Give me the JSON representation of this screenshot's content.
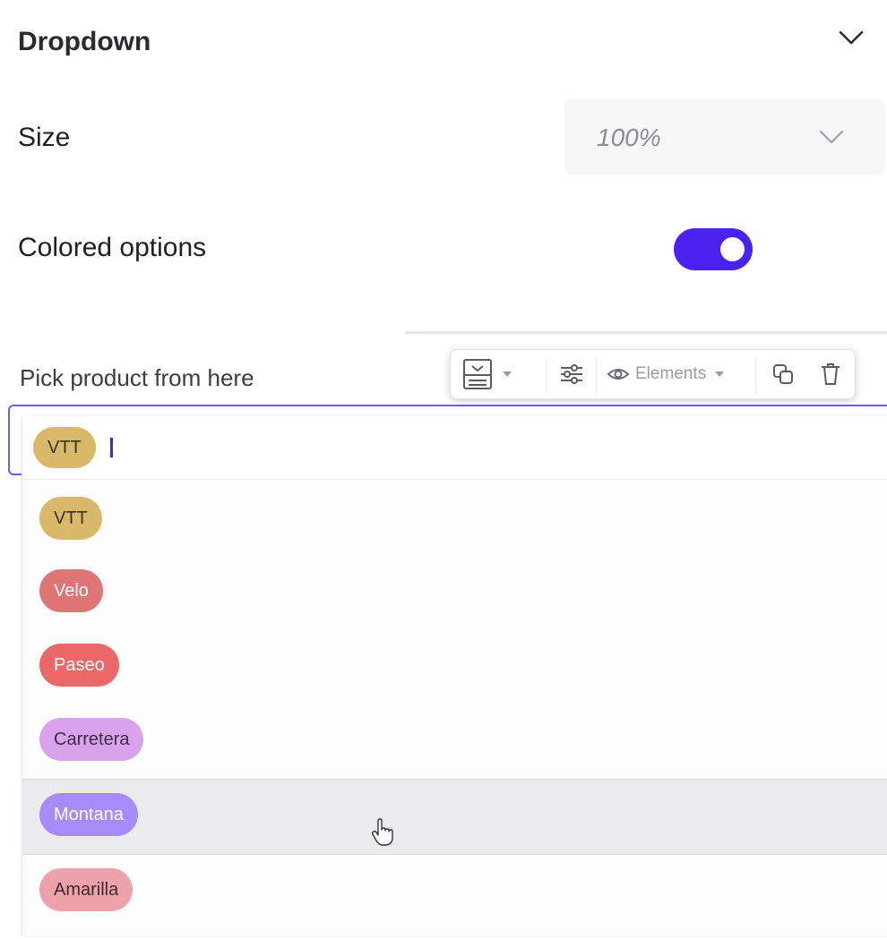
{
  "section": {
    "title": "Dropdown"
  },
  "size": {
    "label": "Size",
    "value": "100%"
  },
  "colored_options": {
    "label": "Colored options",
    "enabled": true,
    "toggle_color": "#4a22f0"
  },
  "field": {
    "label": "Pick product from here",
    "selected_tag": "VTT"
  },
  "toolbar": {
    "elements_label": "Elements"
  },
  "options": [
    {
      "label": "VTT",
      "color": "#d9b969",
      "text_color": "#3a3320"
    },
    {
      "label": "Velo",
      "color": "#e07575",
      "text_color": "#ffffff"
    },
    {
      "label": "Paseo",
      "color": "#ec6767",
      "text_color": "#ffffff"
    },
    {
      "label": "Carretera",
      "color": "#d8a3ec",
      "text_color": "#3c2c44"
    },
    {
      "label": "Montana",
      "color": "#a68cfa",
      "text_color": "#ffffff"
    },
    {
      "label": "Amarilla",
      "color": "#eda1ab",
      "text_color": "#3e2a2e"
    }
  ],
  "hovered_option": "Montana"
}
